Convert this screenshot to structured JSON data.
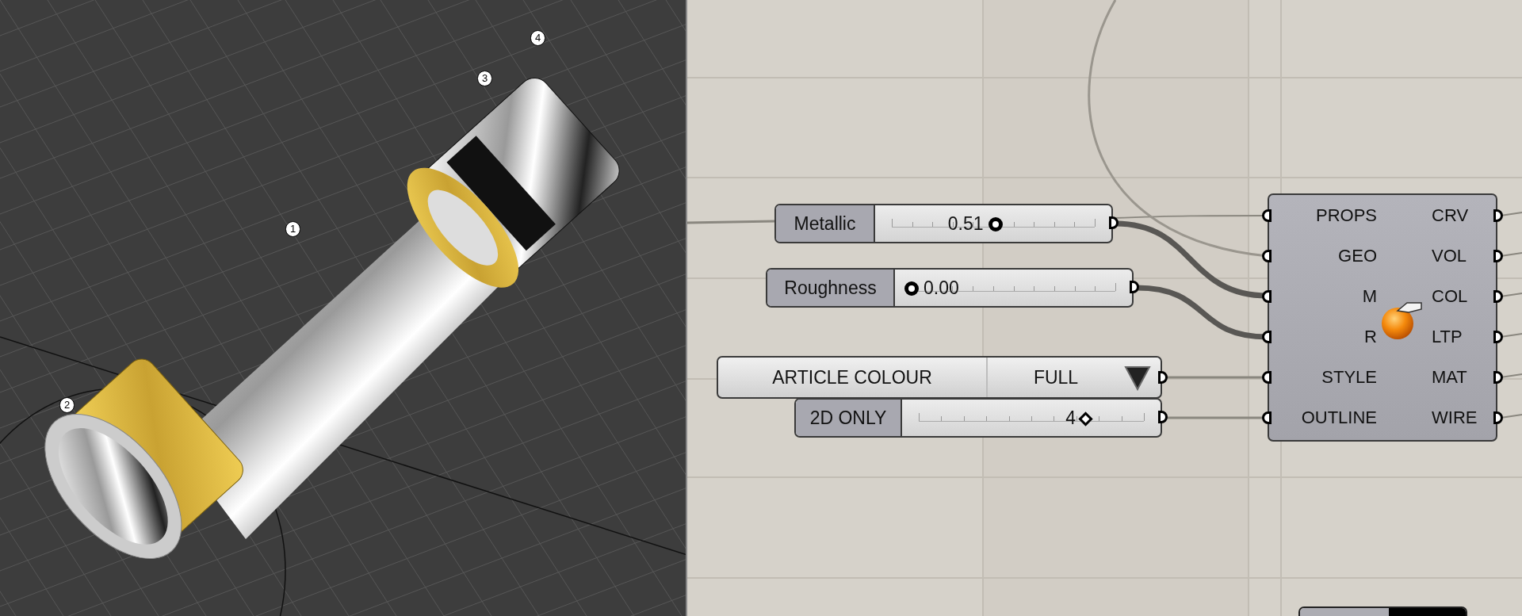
{
  "viewport": {
    "callouts": [
      "1",
      "2",
      "3",
      "4"
    ]
  },
  "canvas": {
    "sliders": [
      {
        "kind": "float",
        "label": "Metallic",
        "value": "0.51",
        "level": 0.51
      },
      {
        "kind": "float",
        "label": "Roughness",
        "value": "0.00",
        "level": 0
      },
      {
        "kind": "integer",
        "label": "2D ONLY",
        "value": "4",
        "level": 0.75
      }
    ],
    "value_list": {
      "label": "ARTICLE COLOUR",
      "value": "FULL"
    },
    "component": {
      "inputs": [
        "PROPS",
        "GEO",
        "M",
        "R",
        "STYLE",
        "OUTLINE"
      ],
      "outputs": [
        "CRV",
        "VOL",
        "COL",
        "LTP",
        "MAT",
        "WIRE"
      ]
    }
  }
}
